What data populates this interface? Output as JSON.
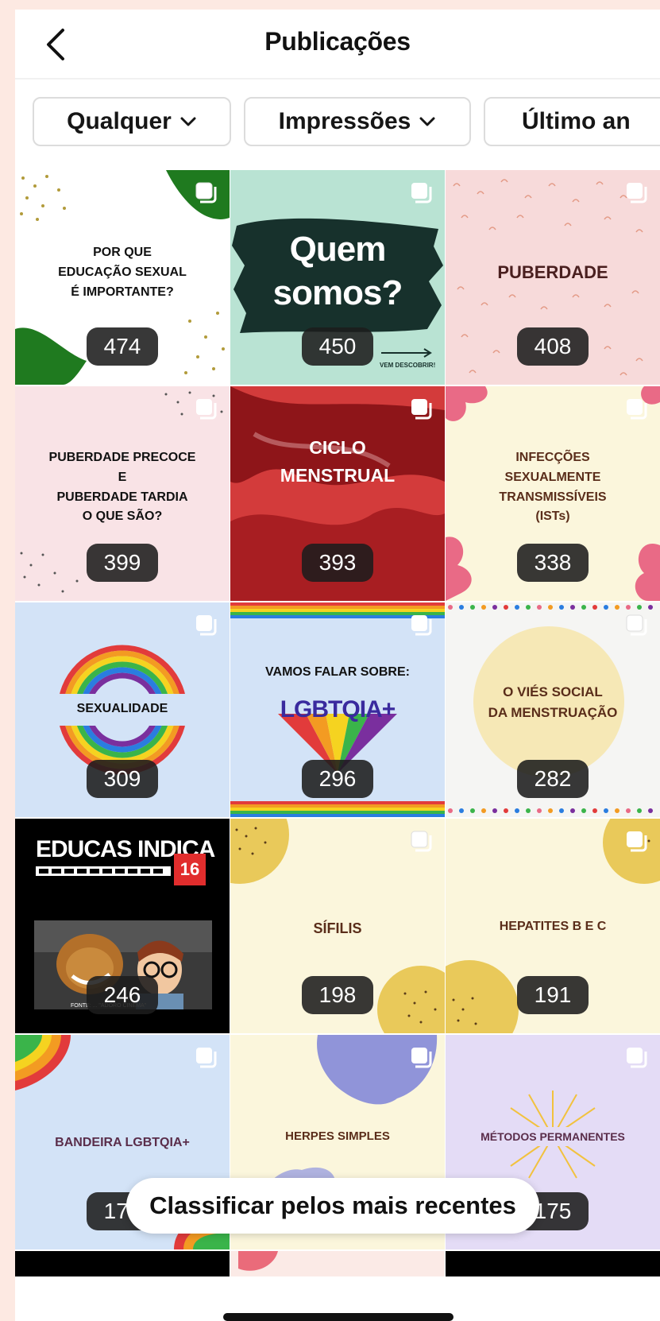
{
  "header": {
    "title": "Publicações"
  },
  "filters": [
    {
      "label": "Qualquer"
    },
    {
      "label": "Impressões"
    },
    {
      "label": "Último an"
    }
  ],
  "posts": [
    {
      "text": "POR QUE\nEDUCAÇÃO SEXUAL\nÉ IMPORTANTE?",
      "count": "474",
      "bg": "#ffffff"
    },
    {
      "text": "Quem\nsomos?",
      "sub": "VEM DESCOBRIR!",
      "count": "450",
      "bg": "#b9e3d3"
    },
    {
      "text": "PUBERDADE",
      "count": "408",
      "bg": "#f7dada"
    },
    {
      "text": "PUBERDADE PRECOCE\nE\nPUBERDADE TARDIA\nO QUE SÃO?",
      "count": "399",
      "bg": "#f9e3e6"
    },
    {
      "text": "CICLO\nMENSTRUAL",
      "count": "393",
      "bg": "#b8262a"
    },
    {
      "text": "INFECÇÕES\nSEXUALMENTE\nTRANSMISSÍVEIS\n(ISTs)",
      "count": "338",
      "bg": "#fbf6dc"
    },
    {
      "text": "SEXUALIDADE",
      "count": "309",
      "bg": "#d3e3f7"
    },
    {
      "text": "VAMOS FALAR SOBRE:",
      "sub": "LGBTQIA+",
      "count": "296",
      "bg": "#d3e3f7"
    },
    {
      "text": "O VIÉS SOCIAL\nDA MENSTRUAÇÃO",
      "count": "282",
      "bg": "#f5f5f3"
    },
    {
      "text": "EDUCAS INDICA",
      "badge16": "16",
      "sub": "FONTE: ... \"ADORO CINEMA\"",
      "count": "246",
      "bg": "#000000"
    },
    {
      "text": "SÍFILIS",
      "count": "198",
      "bg": "#fbf6dc"
    },
    {
      "text": "HEPATITES B E C",
      "count": "191",
      "bg": "#fbf6dc"
    },
    {
      "text": "BANDEIRA LGBTQIA+",
      "count": "178",
      "bg": "#d3e3f7"
    },
    {
      "text": "HERPES SIMPLES",
      "count": "",
      "bg": "#fbf6dc"
    },
    {
      "text": "MÉTODOS PERMANENTES",
      "count": "175",
      "bg": "#e4dcf6"
    }
  ],
  "sort_button": "Classificar pelos mais recentes",
  "colors": {
    "accent_green": "#1f7a1f",
    "badge": "#1c1c1c",
    "text_dark": "#111111"
  }
}
